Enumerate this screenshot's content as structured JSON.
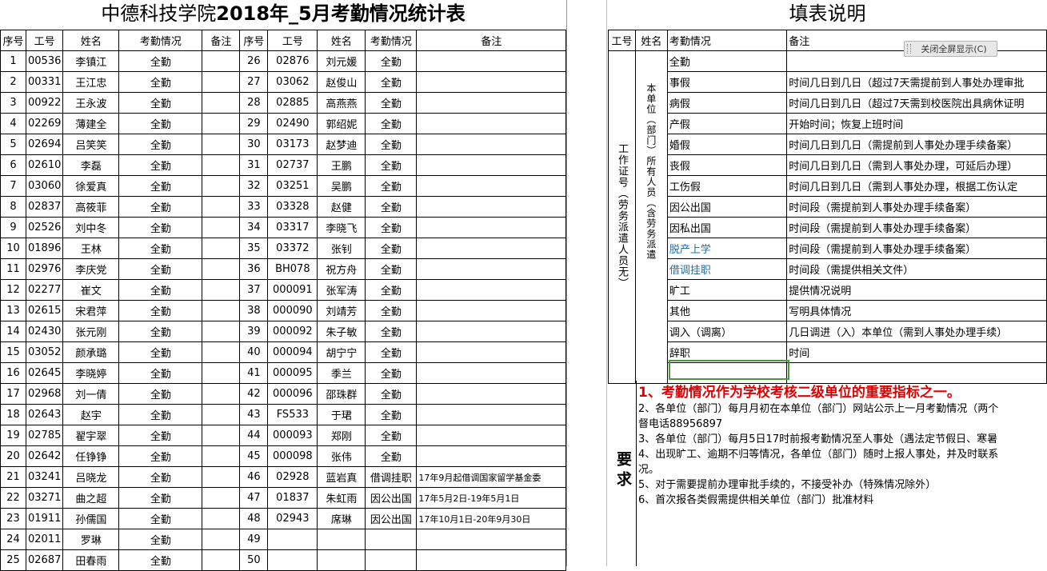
{
  "left": {
    "title_a": "中德科技学院",
    "title_b": "2018年_5月考勤情况统计表",
    "headers": [
      "序号",
      "工号",
      "姓名",
      "考勤情况",
      "备注",
      "序号",
      "工号",
      "姓名",
      "考勤情况",
      "备注"
    ],
    "rows": [
      {
        "n1": "1",
        "id1": "00536",
        "name1": "李镇江",
        "att1": "全勤",
        "n2": "26",
        "id2": "02876",
        "name2": "刘元媛",
        "att2": "全勤",
        "rem2": ""
      },
      {
        "n1": "2",
        "id1": "00331",
        "name1": "王江忠",
        "att1": "全勤",
        "n2": "27",
        "id2": "03062",
        "name2": "赵俊山",
        "att2": "全勤",
        "rem2": ""
      },
      {
        "n1": "3",
        "id1": "00922",
        "name1": "王永波",
        "att1": "全勤",
        "n2": "28",
        "id2": "02885",
        "name2": "高燕燕",
        "att2": "全勤",
        "rem2": ""
      },
      {
        "n1": "4",
        "id1": "02269",
        "name1": "薄建全",
        "att1": "全勤",
        "n2": "29",
        "id2": "02490",
        "name2": "郭绍妮",
        "att2": "全勤",
        "rem2": ""
      },
      {
        "n1": "5",
        "id1": "02694",
        "name1": "吕笑笑",
        "att1": "全勤",
        "n2": "30",
        "id2": "03173",
        "name2": "赵梦迪",
        "att2": "全勤",
        "rem2": ""
      },
      {
        "n1": "6",
        "id1": "02610",
        "name1": "李磊",
        "att1": "全勤",
        "n2": "31",
        "id2": "02737",
        "name2": "王鹏",
        "att2": "全勤",
        "rem2": ""
      },
      {
        "n1": "7",
        "id1": "03060",
        "name1": "徐爱真",
        "att1": "全勤",
        "n2": "32",
        "id2": "03251",
        "name2": "吴鹏",
        "att2": "全勤",
        "rem2": ""
      },
      {
        "n1": "8",
        "id1": "02837",
        "name1": "高筱菲",
        "att1": "全勤",
        "n2": "33",
        "id2": "03328",
        "name2": "赵健",
        "att2": "全勤",
        "rem2": ""
      },
      {
        "n1": "9",
        "id1": "02526",
        "name1": "刘中冬",
        "att1": "全勤",
        "n2": "34",
        "id2": "03317",
        "name2": "李晓飞",
        "att2": "全勤",
        "rem2": ""
      },
      {
        "n1": "10",
        "id1": "01896",
        "name1": "王林",
        "att1": "全勤",
        "n2": "35",
        "id2": "03372",
        "name2": "张钊",
        "att2": "全勤",
        "rem2": ""
      },
      {
        "n1": "11",
        "id1": "02976",
        "name1": "李庆党",
        "att1": "全勤",
        "n2": "36",
        "id2": "BH078",
        "name2": "祝方舟",
        "att2": "全勤",
        "rem2": ""
      },
      {
        "n1": "12",
        "id1": "02277",
        "name1": "崔文",
        "att1": "全勤",
        "n2": "37",
        "id2": "000091",
        "name2": "张军涛",
        "att2": "全勤",
        "rem2": ""
      },
      {
        "n1": "13",
        "id1": "02615",
        "name1": "宋君萍",
        "att1": "全勤",
        "n2": "38",
        "id2": "000090",
        "name2": "刘靖芳",
        "att2": "全勤",
        "rem2": ""
      },
      {
        "n1": "14",
        "id1": "02430",
        "name1": "张元刚",
        "att1": "全勤",
        "n2": "39",
        "id2": "000092",
        "name2": "朱子敏",
        "att2": "全勤",
        "rem2": ""
      },
      {
        "n1": "15",
        "id1": "03052",
        "name1": "颜承璐",
        "att1": "全勤",
        "n2": "40",
        "id2": "000094",
        "name2": "胡宁宁",
        "att2": "全勤",
        "rem2": ""
      },
      {
        "n1": "16",
        "id1": "02645",
        "name1": "李晓婷",
        "att1": "全勤",
        "n2": "41",
        "id2": "000095",
        "name2": "季兰",
        "att2": "全勤",
        "rem2": ""
      },
      {
        "n1": "17",
        "id1": "02968",
        "name1": "刘一倩",
        "att1": "全勤",
        "n2": "42",
        "id2": "000096",
        "name2": "邵珠群",
        "att2": "全勤",
        "rem2": ""
      },
      {
        "n1": "18",
        "id1": "02643",
        "name1": "赵宇",
        "att1": "全勤",
        "n2": "43",
        "id2": "FS533",
        "name2": "于珺",
        "att2": "全勤",
        "rem2": ""
      },
      {
        "n1": "19",
        "id1": "02785",
        "name1": "翟宇翠",
        "att1": "全勤",
        "n2": "44",
        "id2": "000093",
        "name2": "郑刚",
        "att2": "全勤",
        "rem2": ""
      },
      {
        "n1": "20",
        "id1": "02642",
        "name1": "任铮铮",
        "att1": "全勤",
        "n2": "45",
        "id2": "000098",
        "name2": "张伟",
        "att2": "全勤",
        "rem2": ""
      },
      {
        "n1": "21",
        "id1": "03241",
        "name1": "吕晓龙",
        "att1": "全勤",
        "n2": "46",
        "id2": "02928",
        "name2": "蓝岩真",
        "att2": "借调挂职",
        "rem2": "17年9月起借调国家留学基金委"
      },
      {
        "n1": "22",
        "id1": "03271",
        "name1": "曲之超",
        "att1": "全勤",
        "n2": "47",
        "id2": "01837",
        "name2": "朱虹雨",
        "att2": "因公出国",
        "rem2": "17年5月2日-19年5月1日"
      },
      {
        "n1": "23",
        "id1": "01911",
        "name1": "孙儒国",
        "att1": "全勤",
        "n2": "48",
        "id2": "02943",
        "name2": "席琳",
        "att2": "因公出国",
        "rem2": "17年10月1日-20年9月30日"
      },
      {
        "n1": "24",
        "id1": "02011",
        "name1": "罗琳",
        "att1": "全勤",
        "n2": "49",
        "id2": "",
        "name2": "",
        "att2": "",
        "rem2": ""
      },
      {
        "n1": "25",
        "id1": "02687",
        "name1": "田春雨",
        "att1": "全勤",
        "n2": "50",
        "id2": "",
        "name2": "",
        "att2": "",
        "rem2": ""
      }
    ]
  },
  "right": {
    "title": "填表说明",
    "headers": [
      "工号",
      "姓名",
      "考勤情况",
      "备注"
    ],
    "vertical_id": "工作证号（劳务派遣人员无）",
    "vertical_name": "本单位（部门）所有人员（含劳务派遣",
    "rows": [
      {
        "type": "全勤",
        "note": "",
        "blue": false
      },
      {
        "type": "事假",
        "note": "时间几日到几日（超过7天需提前到人事处办理审批",
        "blue": false
      },
      {
        "type": "病假",
        "note": "时间几日到几日（超过7天需到校医院出具病休证明",
        "blue": false
      },
      {
        "type": "产假",
        "note": "开始时间；恢复上班时间",
        "blue": false
      },
      {
        "type": "婚假",
        "note": "时间几日到几日（需提前到人事处办理手续备案）",
        "blue": false
      },
      {
        "type": "丧假",
        "note": "时间几日到几日（需到人事处办理，可延后办理）",
        "blue": false
      },
      {
        "type": "工伤假",
        "note": "时间几日到几日（需到人事处办理，根据工伤认定",
        "blue": false
      },
      {
        "type": "因公出国",
        "note": "时间段（需提前到人事处办理手续备案）",
        "blue": false
      },
      {
        "type": "因私出国",
        "note": "时间段（需提前到人事处办理手续备案）",
        "blue": false
      },
      {
        "type": "脱产上学",
        "note": "时间段（需提前到人事处办理手续备案）",
        "blue": true
      },
      {
        "type": "借调挂职",
        "note": "时间段（需提供相关文件）",
        "blue": true
      },
      {
        "type": "旷工",
        "note": "提供情况说明",
        "blue": false
      },
      {
        "type": "其他",
        "note": "写明具体情况",
        "blue": false
      },
      {
        "type": "调入（调离）",
        "note": "几日调进（入）本单位（需到人事处办理手续）",
        "blue": false
      },
      {
        "type": "辞职",
        "note": "时间",
        "blue": false
      }
    ],
    "requirements_label": "要求",
    "requirements": [
      "1、考勤情况作为学校考核二级单位的重要指标之一。",
      "2、各单位（部门）每月月初在本单位（部门）网站公示上一月考勤情况（两个",
      "督电话88956897",
      "3、各单位（部门）每月5日17时前报考勤情况至人事处（遇法定节假日、寒暑",
      "4、出现旷工、逾期不归等情况，各单位（部门）随时上报人事处，并及时联系",
      "况。",
      "5、对于需要提前办理审批手续的，不接受补办（特殊情况除外）",
      "6、首次报各类假需提供相关单位（部门）批准材料"
    ]
  },
  "toolbar": {
    "exit_fullscreen": "关闭全屏显示(C)"
  }
}
